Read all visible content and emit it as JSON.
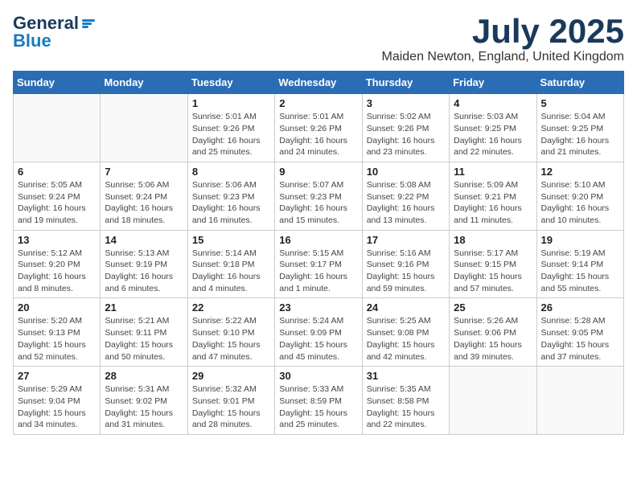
{
  "header": {
    "logo_general": "General",
    "logo_blue": "Blue",
    "month_title": "July 2025",
    "location": "Maiden Newton, England, United Kingdom"
  },
  "calendar": {
    "headers": [
      "Sunday",
      "Monday",
      "Tuesday",
      "Wednesday",
      "Thursday",
      "Friday",
      "Saturday"
    ],
    "weeks": [
      [
        {
          "day": "",
          "sunrise": "",
          "sunset": "",
          "daylight": ""
        },
        {
          "day": "",
          "sunrise": "",
          "sunset": "",
          "daylight": ""
        },
        {
          "day": "1",
          "sunrise": "Sunrise: 5:01 AM",
          "sunset": "Sunset: 9:26 PM",
          "daylight": "Daylight: 16 hours and 25 minutes."
        },
        {
          "day": "2",
          "sunrise": "Sunrise: 5:01 AM",
          "sunset": "Sunset: 9:26 PM",
          "daylight": "Daylight: 16 hours and 24 minutes."
        },
        {
          "day": "3",
          "sunrise": "Sunrise: 5:02 AM",
          "sunset": "Sunset: 9:26 PM",
          "daylight": "Daylight: 16 hours and 23 minutes."
        },
        {
          "day": "4",
          "sunrise": "Sunrise: 5:03 AM",
          "sunset": "Sunset: 9:25 PM",
          "daylight": "Daylight: 16 hours and 22 minutes."
        },
        {
          "day": "5",
          "sunrise": "Sunrise: 5:04 AM",
          "sunset": "Sunset: 9:25 PM",
          "daylight": "Daylight: 16 hours and 21 minutes."
        }
      ],
      [
        {
          "day": "6",
          "sunrise": "Sunrise: 5:05 AM",
          "sunset": "Sunset: 9:24 PM",
          "daylight": "Daylight: 16 hours and 19 minutes."
        },
        {
          "day": "7",
          "sunrise": "Sunrise: 5:06 AM",
          "sunset": "Sunset: 9:24 PM",
          "daylight": "Daylight: 16 hours and 18 minutes."
        },
        {
          "day": "8",
          "sunrise": "Sunrise: 5:06 AM",
          "sunset": "Sunset: 9:23 PM",
          "daylight": "Daylight: 16 hours and 16 minutes."
        },
        {
          "day": "9",
          "sunrise": "Sunrise: 5:07 AM",
          "sunset": "Sunset: 9:23 PM",
          "daylight": "Daylight: 16 hours and 15 minutes."
        },
        {
          "day": "10",
          "sunrise": "Sunrise: 5:08 AM",
          "sunset": "Sunset: 9:22 PM",
          "daylight": "Daylight: 16 hours and 13 minutes."
        },
        {
          "day": "11",
          "sunrise": "Sunrise: 5:09 AM",
          "sunset": "Sunset: 9:21 PM",
          "daylight": "Daylight: 16 hours and 11 minutes."
        },
        {
          "day": "12",
          "sunrise": "Sunrise: 5:10 AM",
          "sunset": "Sunset: 9:20 PM",
          "daylight": "Daylight: 16 hours and 10 minutes."
        }
      ],
      [
        {
          "day": "13",
          "sunrise": "Sunrise: 5:12 AM",
          "sunset": "Sunset: 9:20 PM",
          "daylight": "Daylight: 16 hours and 8 minutes."
        },
        {
          "day": "14",
          "sunrise": "Sunrise: 5:13 AM",
          "sunset": "Sunset: 9:19 PM",
          "daylight": "Daylight: 16 hours and 6 minutes."
        },
        {
          "day": "15",
          "sunrise": "Sunrise: 5:14 AM",
          "sunset": "Sunset: 9:18 PM",
          "daylight": "Daylight: 16 hours and 4 minutes."
        },
        {
          "day": "16",
          "sunrise": "Sunrise: 5:15 AM",
          "sunset": "Sunset: 9:17 PM",
          "daylight": "Daylight: 16 hours and 1 minute."
        },
        {
          "day": "17",
          "sunrise": "Sunrise: 5:16 AM",
          "sunset": "Sunset: 9:16 PM",
          "daylight": "Daylight: 15 hours and 59 minutes."
        },
        {
          "day": "18",
          "sunrise": "Sunrise: 5:17 AM",
          "sunset": "Sunset: 9:15 PM",
          "daylight": "Daylight: 15 hours and 57 minutes."
        },
        {
          "day": "19",
          "sunrise": "Sunrise: 5:19 AM",
          "sunset": "Sunset: 9:14 PM",
          "daylight": "Daylight: 15 hours and 55 minutes."
        }
      ],
      [
        {
          "day": "20",
          "sunrise": "Sunrise: 5:20 AM",
          "sunset": "Sunset: 9:13 PM",
          "daylight": "Daylight: 15 hours and 52 minutes."
        },
        {
          "day": "21",
          "sunrise": "Sunrise: 5:21 AM",
          "sunset": "Sunset: 9:11 PM",
          "daylight": "Daylight: 15 hours and 50 minutes."
        },
        {
          "day": "22",
          "sunrise": "Sunrise: 5:22 AM",
          "sunset": "Sunset: 9:10 PM",
          "daylight": "Daylight: 15 hours and 47 minutes."
        },
        {
          "day": "23",
          "sunrise": "Sunrise: 5:24 AM",
          "sunset": "Sunset: 9:09 PM",
          "daylight": "Daylight: 15 hours and 45 minutes."
        },
        {
          "day": "24",
          "sunrise": "Sunrise: 5:25 AM",
          "sunset": "Sunset: 9:08 PM",
          "daylight": "Daylight: 15 hours and 42 minutes."
        },
        {
          "day": "25",
          "sunrise": "Sunrise: 5:26 AM",
          "sunset": "Sunset: 9:06 PM",
          "daylight": "Daylight: 15 hours and 39 minutes."
        },
        {
          "day": "26",
          "sunrise": "Sunrise: 5:28 AM",
          "sunset": "Sunset: 9:05 PM",
          "daylight": "Daylight: 15 hours and 37 minutes."
        }
      ],
      [
        {
          "day": "27",
          "sunrise": "Sunrise: 5:29 AM",
          "sunset": "Sunset: 9:04 PM",
          "daylight": "Daylight: 15 hours and 34 minutes."
        },
        {
          "day": "28",
          "sunrise": "Sunrise: 5:31 AM",
          "sunset": "Sunset: 9:02 PM",
          "daylight": "Daylight: 15 hours and 31 minutes."
        },
        {
          "day": "29",
          "sunrise": "Sunrise: 5:32 AM",
          "sunset": "Sunset: 9:01 PM",
          "daylight": "Daylight: 15 hours and 28 minutes."
        },
        {
          "day": "30",
          "sunrise": "Sunrise: 5:33 AM",
          "sunset": "Sunset: 8:59 PM",
          "daylight": "Daylight: 15 hours and 25 minutes."
        },
        {
          "day": "31",
          "sunrise": "Sunrise: 5:35 AM",
          "sunset": "Sunset: 8:58 PM",
          "daylight": "Daylight: 15 hours and 22 minutes."
        },
        {
          "day": "",
          "sunrise": "",
          "sunset": "",
          "daylight": ""
        },
        {
          "day": "",
          "sunrise": "",
          "sunset": "",
          "daylight": ""
        }
      ]
    ]
  }
}
